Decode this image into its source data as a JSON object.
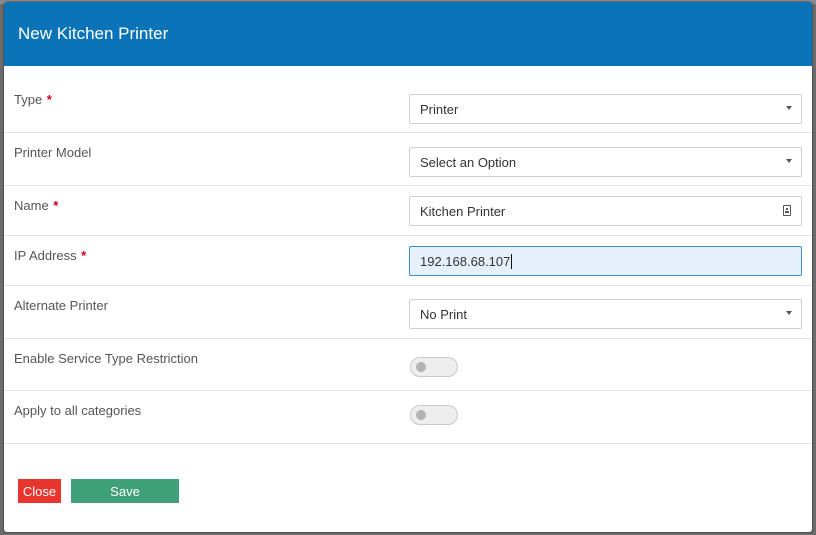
{
  "modal": {
    "title": "New Kitchen Printer",
    "header_color": "#0b74b8"
  },
  "fields": {
    "type": {
      "label": "Type",
      "required": "*",
      "value": "Printer"
    },
    "printer_model": {
      "label": "Printer Model",
      "value": "Select an Option"
    },
    "name": {
      "label": "Name",
      "required": "*",
      "value": "Kitchen Printer"
    },
    "ip_address": {
      "label": "IP Address",
      "required": "*",
      "value": "192.168.68.107"
    },
    "alternate_printer": {
      "label": "Alternate Printer",
      "value": "No Print"
    },
    "service_type_restriction": {
      "label": "Enable Service Type Restriction",
      "enabled": false
    },
    "apply_all_categories": {
      "label": "Apply to all categories",
      "enabled": false
    }
  },
  "buttons": {
    "close_label": "Close",
    "close_color": "#e8352e",
    "save_label": "Save",
    "save_color": "#3fa17a"
  },
  "icons": {
    "dropdown": "chevron-down-icon",
    "name_field": "contact-card-icon"
  }
}
